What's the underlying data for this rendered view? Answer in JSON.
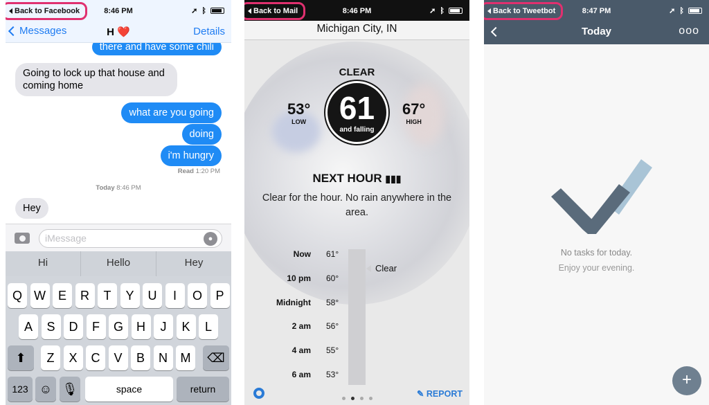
{
  "messages_screen": {
    "back_pill": "Back to Facebook",
    "time": "8:46 PM",
    "nav": {
      "back": "Messages",
      "title": "H ❤️",
      "details": "Details"
    },
    "bubbles": [
      {
        "dir": "out",
        "text": "there and have some chili"
      },
      {
        "dir": "in",
        "text": "Going to lock up that house and coming home"
      },
      {
        "dir": "out",
        "text": "what are you going"
      },
      {
        "dir": "out",
        "text": "doing"
      },
      {
        "dir": "out",
        "text": "i'm hungry"
      },
      {
        "dir": "in",
        "text": "Hey"
      }
    ],
    "read_receipt": {
      "label": "Read",
      "time": "1:20 PM"
    },
    "timestamp": {
      "label": "Today",
      "time": "8:46 PM"
    },
    "input_placeholder": "iMessage",
    "predictions": [
      "Hi",
      "Hello",
      "Hey"
    ],
    "keyboard": {
      "row1": [
        "Q",
        "W",
        "E",
        "R",
        "T",
        "Y",
        "U",
        "I",
        "O",
        "P"
      ],
      "row2": [
        "A",
        "S",
        "D",
        "F",
        "G",
        "H",
        "J",
        "K",
        "L"
      ],
      "row3": [
        "Z",
        "X",
        "C",
        "V",
        "B",
        "N",
        "M"
      ],
      "numbers_key": "123",
      "space_key": "space",
      "return_key": "return"
    }
  },
  "weather_screen": {
    "back_pill": "Back to Mail",
    "time": "8:46 PM",
    "city": "Michigan City, IN",
    "condition": "CLEAR",
    "current_temp": "61",
    "trend": "and falling",
    "low": {
      "value": "53°",
      "label": "LOW"
    },
    "high": {
      "value": "67°",
      "label": "HIGH"
    },
    "next_hour_title": "NEXT HOUR",
    "summary": "Clear for the hour. No rain anywhere in the area.",
    "timeline_label": "Clear",
    "hourly": [
      {
        "time": "Now",
        "temp": "61°"
      },
      {
        "time": "10 pm",
        "temp": "60°"
      },
      {
        "time": "Midnight",
        "temp": "58°"
      },
      {
        "time": "2 am",
        "temp": "56°"
      },
      {
        "time": "4 am",
        "temp": "55°"
      },
      {
        "time": "6 am",
        "temp": "53°"
      }
    ],
    "report_label": "REPORT"
  },
  "tasks_screen": {
    "back_pill": "Back to Tweetbot",
    "time": "8:47 PM",
    "title": "Today",
    "more": "ooo",
    "empty_title": "No tasks for today.",
    "empty_subtitle": "Enjoy your evening.",
    "add_label": "+"
  },
  "colors": {
    "imessage_blue": "#1f8bf5",
    "link_blue": "#1f7cf2",
    "highlight_pink": "#e0306f",
    "tasks_header": "#4a5a6a",
    "check_dark": "#5a6b7b",
    "check_light": "#a9c4d6"
  }
}
